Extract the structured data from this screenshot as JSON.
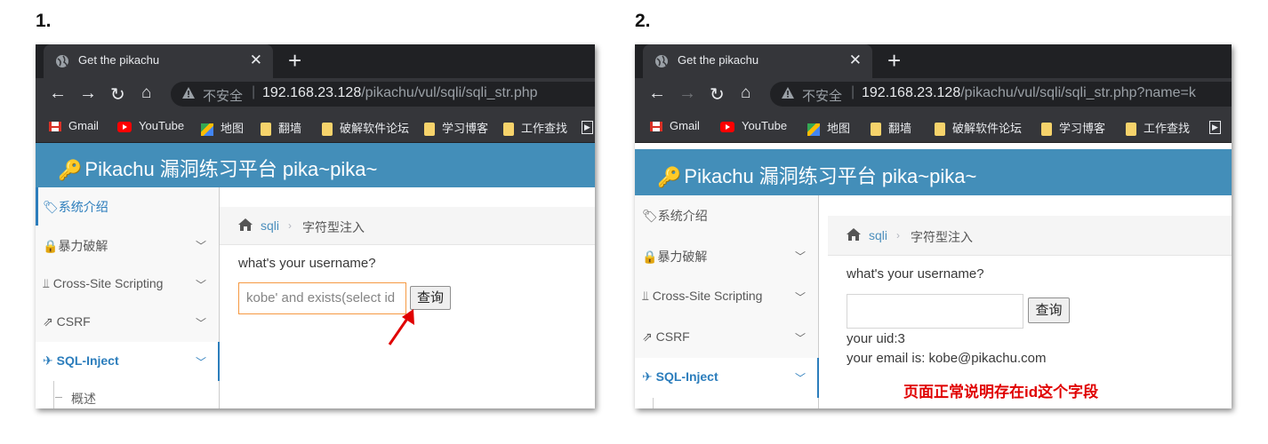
{
  "steps": [
    "1.",
    "2."
  ],
  "browser": {
    "tab_title": "Get the pikachu",
    "tab_close": "✕",
    "new_tab": "+",
    "insecure_label": "不安全",
    "bookmarks": [
      "Gmail",
      "YouTube",
      "地图",
      "翻墙",
      "破解软件论坛",
      "学习博客",
      "工作查找"
    ]
  },
  "screen1": {
    "url_host": "192.168.23.128",
    "url_path": "/pikachu/vul/sqli/sqli_str.php",
    "input_value": "kobe' and exists(select id",
    "button_label": "查询"
  },
  "screen2": {
    "url_host": "192.168.23.128",
    "url_path": "/pikachu/vul/sqli/sqli_str.php?name=k",
    "input_value": "",
    "button_label": "查询",
    "result_uid": "your uid:3",
    "result_email": "your email is: kobe@pikachu.com",
    "annotation": "页面正常说明存在id这个字段"
  },
  "site": {
    "brand": "Pikachu 漏洞练习平台 pika~pika~",
    "sidebar": [
      "系统介绍",
      "暴力破解",
      "Cross-Site Scripting",
      "CSRF",
      "SQL-Inject"
    ],
    "sub_item": "概述",
    "breadcrumb_1": "sqli",
    "breadcrumb_2": "字符型注入",
    "question": "what's your username?"
  },
  "colors": {
    "header": "#438eb9",
    "accent": "#2b7dbc",
    "focus_border": "#f59942",
    "annotation": "#e00000"
  }
}
